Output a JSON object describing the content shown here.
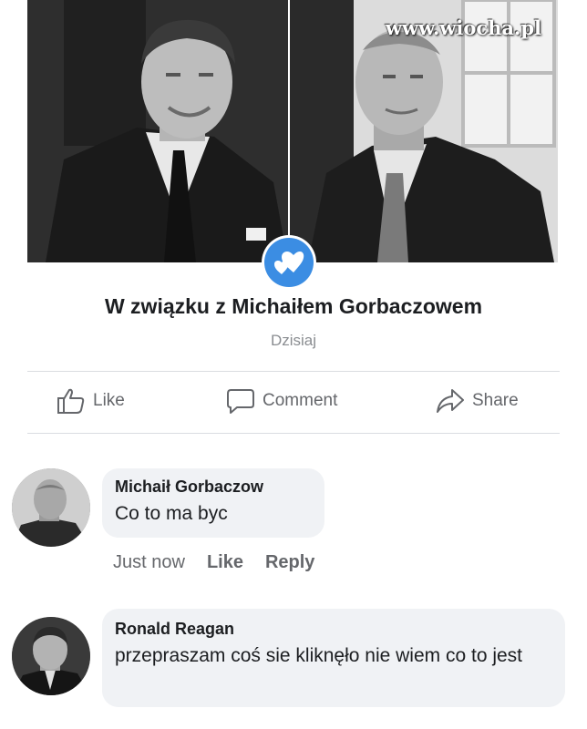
{
  "cover": {
    "watermark": "www.wiocha.pl"
  },
  "event": {
    "title": "W związku z Michaiłem Gorbaczowem",
    "date": "Dzisiaj",
    "badge_icon": "hearts-icon",
    "badge_color": "#3b8de3"
  },
  "actions": {
    "like": {
      "label": "Like",
      "icon": "thumbs-up-icon"
    },
    "comment": {
      "label": "Comment",
      "icon": "comment-bubble-icon"
    },
    "share": {
      "label": "Share",
      "icon": "share-arrow-icon"
    }
  },
  "comments": [
    {
      "author": "Michaił Gorbaczow",
      "text": "Co to ma byc",
      "time": "Just now",
      "like_label": "Like",
      "reply_label": "Reply"
    },
    {
      "author": "Ronald Reagan",
      "text": "przepraszam coś sie kliknęło nie wiem co to jest"
    }
  ],
  "colors": {
    "bubble_bg": "#f0f2f5",
    "muted_text": "#65676b",
    "divider": "#dadde1"
  }
}
